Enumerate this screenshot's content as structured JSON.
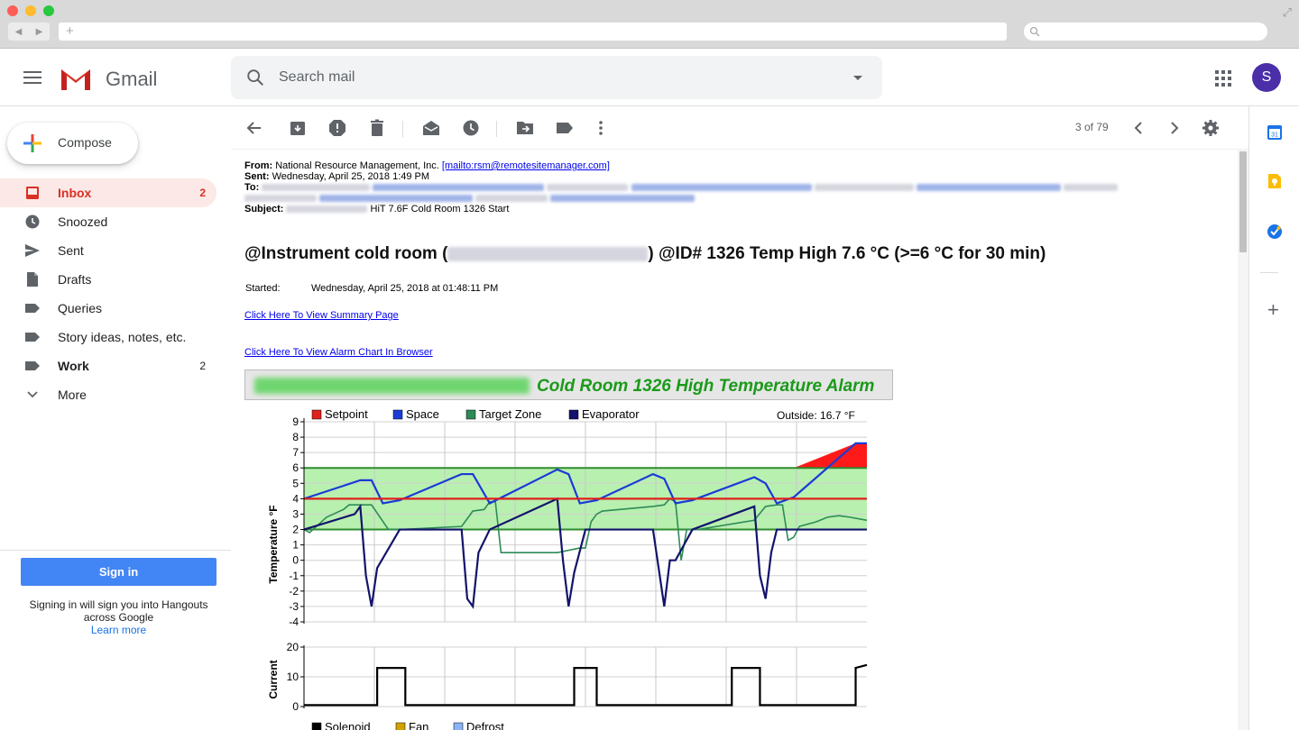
{
  "gmail": {
    "logo_text": "Gmail",
    "search_placeholder": "Search mail",
    "avatar_letter": "S"
  },
  "sidebar": {
    "compose_label": "Compose",
    "items": [
      {
        "label": "Inbox",
        "count": "2",
        "icon": "inbox-icon",
        "active": true
      },
      {
        "label": "Snoozed",
        "count": "",
        "icon": "clock-icon"
      },
      {
        "label": "Sent",
        "count": "",
        "icon": "send-icon"
      },
      {
        "label": "Drafts",
        "count": "",
        "icon": "draft-icon"
      },
      {
        "label": "Queries",
        "count": "",
        "icon": "label-icon"
      },
      {
        "label": "Story ideas, notes, etc.",
        "count": "",
        "icon": "label-icon"
      },
      {
        "label": "Work",
        "count": "2",
        "icon": "label-icon",
        "bold": true
      },
      {
        "label": "More",
        "count": "",
        "icon": "chevron-down-icon"
      }
    ],
    "signin_button": "Sign in",
    "signin_text": "Signing in will sign you into Hangouts across Google",
    "learn_more": "Learn more"
  },
  "toolbar": {
    "pager": "3 of 79"
  },
  "email": {
    "from_label": "From:",
    "from_value": "National Resource Management, Inc. ",
    "from_link": "[mailto:rsm@remotesitemanager.com]",
    "sent_label": "Sent:",
    "sent_value": "Wednesday, April 25, 2018 1:49 PM",
    "to_label": "To:",
    "subject_label": "Subject:",
    "subject_value": "HiT 7.6F Cold Room 1326 Start",
    "headline_pre": "@Instrument cold room (",
    "headline_post": ") @ID# 1326 Temp High 7.6 °C (>=6 °C for 30 min)",
    "started_label": "Started:",
    "started_value": "Wednesday, April 25, 2018 at 01:48:11 PM",
    "link_summary": "Click Here To View Summary Page",
    "link_chart": "Click Here To View Alarm Chart In Browser"
  },
  "chart_data": [
    {
      "type": "line",
      "title": "Cold Room 1326 High Temperature Alarm",
      "annotation": "Outside: 16.7 °F",
      "ylabel": "Temperature °F",
      "xlabel": "",
      "ylim": [
        -4,
        9
      ],
      "yticks": [
        "9",
        "8",
        "7",
        "6",
        "5",
        "4",
        "3",
        "2",
        "1",
        "0",
        "-1",
        "-2",
        "-3",
        "-4"
      ],
      "grid": true,
      "legend_position": "top",
      "target_zone": [
        2,
        6
      ],
      "series": [
        {
          "name": "Setpoint",
          "color": "#e0201b",
          "x": [
            0,
            100
          ],
          "values": [
            4,
            4
          ]
        },
        {
          "name": "Space",
          "color": "#1a3bd6",
          "x": [
            0,
            10,
            12,
            14,
            17,
            28,
            30,
            33,
            45,
            47,
            49,
            52,
            62,
            64,
            66,
            69,
            80,
            82,
            84,
            87,
            98,
            100
          ],
          "values": [
            4.0,
            5.2,
            5.2,
            3.7,
            3.9,
            5.6,
            5.6,
            3.7,
            5.9,
            5.6,
            3.7,
            3.9,
            5.6,
            5.3,
            3.7,
            3.9,
            5.4,
            5.0,
            3.7,
            4.1,
            7.6,
            7.6
          ]
        },
        {
          "name": "Target Zone",
          "color": "#2e8b57",
          "x": [
            0,
            1,
            4,
            7,
            8,
            9,
            10,
            12,
            15,
            16,
            17,
            28,
            30,
            32,
            33,
            34,
            35,
            45,
            49,
            50,
            51,
            52,
            53,
            62,
            64,
            65,
            66,
            67,
            68,
            70,
            80,
            82,
            84,
            85,
            86,
            87,
            88,
            91,
            93,
            95,
            97,
            100
          ],
          "values": [
            2.0,
            1.8,
            2.8,
            3.3,
            3.6,
            3.6,
            3.6,
            3.6,
            2.0,
            2.0,
            2.0,
            2.2,
            3.2,
            3.3,
            3.8,
            3.8,
            0.5,
            0.5,
            0.8,
            0.8,
            2.5,
            3.0,
            3.2,
            3.5,
            3.6,
            4.0,
            3.8,
            0.0,
            2.0,
            2.0,
            2.6,
            3.5,
            3.6,
            3.6,
            1.3,
            1.5,
            2.2,
            2.5,
            2.8,
            2.9,
            2.8,
            2.6
          ]
        },
        {
          "name": "Evaporator",
          "color": "#13136b",
          "x": [
            0,
            9,
            10,
            11,
            12,
            13,
            17,
            28,
            29,
            30,
            31,
            33,
            45,
            46,
            47,
            48,
            50,
            52,
            62,
            63,
            64,
            65,
            66,
            69,
            80,
            81,
            82,
            83,
            84,
            87,
            100
          ],
          "values": [
            2.0,
            3.0,
            3.5,
            -1.0,
            -3.0,
            -0.5,
            2.0,
            2.0,
            -2.5,
            -3.0,
            0.5,
            2.0,
            4.0,
            0.0,
            -3.0,
            -0.8,
            2.0,
            2.0,
            2.0,
            -0.5,
            -3.0,
            0.0,
            0.0,
            2.0,
            3.5,
            -1.0,
            -2.5,
            0.5,
            2.0,
            2.0,
            2.0
          ]
        }
      ]
    },
    {
      "type": "line",
      "title": "",
      "ylabel": "Current",
      "ylim": [
        0,
        20
      ],
      "yticks": [
        "20",
        "10",
        "0"
      ],
      "grid": true,
      "legend_position": "bottom",
      "series": [
        {
          "name": "Solenoid",
          "color": "#000000",
          "x": [
            0,
            13,
            13,
            18,
            18,
            48,
            48,
            52,
            52,
            76,
            76,
            81,
            81,
            98,
            98,
            100
          ],
          "values": [
            0.5,
            0.5,
            13,
            13,
            0.5,
            0.5,
            13,
            13,
            0.5,
            0.5,
            13,
            13,
            0.5,
            0.5,
            13,
            14
          ]
        },
        {
          "name": "Fan",
          "color": "#d4a000",
          "x": [],
          "values": []
        },
        {
          "name": "Defrost",
          "color": "#8ab4f8",
          "x": [],
          "values": []
        }
      ]
    }
  ]
}
